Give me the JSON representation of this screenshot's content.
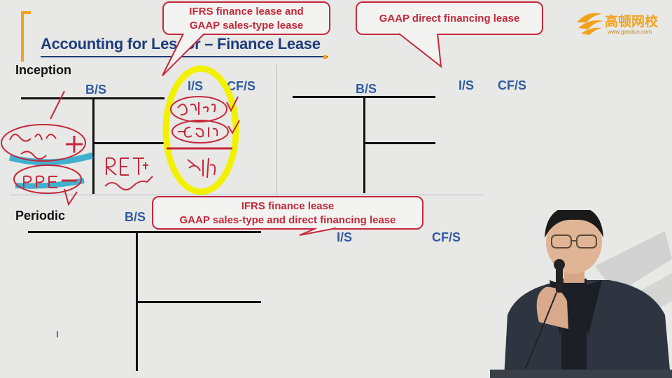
{
  "slide": {
    "title": "Accounting for Lessor – Finance Lease",
    "sections": {
      "inception": "Inception",
      "periodic": "Periodic"
    },
    "statements": {
      "bs": "B/S",
      "is": "I/S",
      "cfs": "CF/S"
    },
    "callouts": {
      "ifrs_top": [
        "IFRS finance lease and",
        "GAAP sales-type lease"
      ],
      "gaap_direct": "GAAP direct financing lease",
      "periodic": [
        "IFRS finance lease",
        "GAAP sales-type and direct financing lease"
      ]
    },
    "logo": {
      "name": "高顿网校",
      "url": "www.gaodun.com"
    }
  },
  "colors": {
    "accent_orange": "#f2a21b",
    "title_blue": "#1e3d7a",
    "statement_blue": "#2f5aa3",
    "callout_red": "#c4293b",
    "highlight_yellow": "#f2f200",
    "highlight_cyan": "#23a6c9"
  }
}
